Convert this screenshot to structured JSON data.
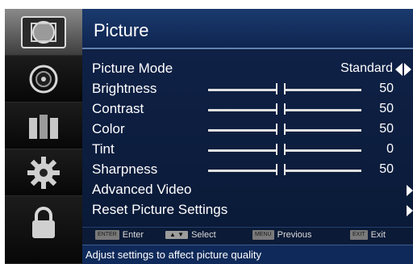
{
  "sidebar": {
    "items": [
      {
        "icon": "picture-icon",
        "active": true
      },
      {
        "icon": "sound-icon",
        "active": false
      },
      {
        "icon": "channel-icon",
        "active": false
      },
      {
        "icon": "settings-gear-icon",
        "active": false
      },
      {
        "icon": "lock-icon",
        "active": false
      }
    ]
  },
  "header": {
    "title": "Picture"
  },
  "menu": {
    "picture_mode": {
      "label": "Picture Mode",
      "value": "Standard"
    },
    "sliders": [
      {
        "label": "Brightness",
        "value": "50",
        "level": 0.5
      },
      {
        "label": "Contrast",
        "value": "50",
        "level": 0.5
      },
      {
        "label": "Color",
        "value": "50",
        "level": 0.5
      },
      {
        "label": "Tint",
        "value": "0",
        "level": 0.5
      },
      {
        "label": "Sharpness",
        "value": "50",
        "level": 0.5
      }
    ],
    "advanced_video": {
      "label": "Advanced Video"
    },
    "reset": {
      "label": "Reset Picture Settings"
    }
  },
  "nav": {
    "enter_key": "ENTER",
    "enter_label": "Enter",
    "select_key": "▲ ▼",
    "select_label": "Select",
    "menu_key": "MENU",
    "menu_label": "Previous",
    "exit_key": "EXIT",
    "exit_label": "Exit"
  },
  "help": {
    "text": "Adjust settings to affect picture quality"
  },
  "colors": {
    "panel": "#0e1e3d",
    "title_bar": "#1a3a6e",
    "help_bar": "#0f2a5a",
    "sidebar_active": "#8a8a8a"
  }
}
